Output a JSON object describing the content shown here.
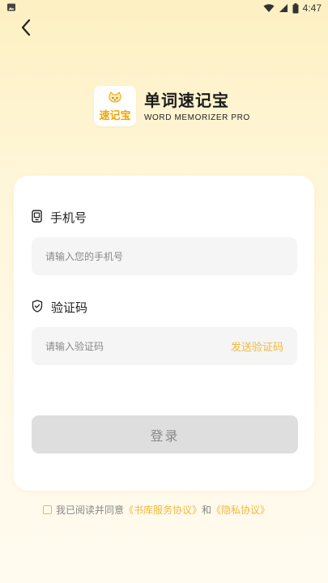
{
  "status_bar": {
    "time": "4:47",
    "left_icon": "image-icon",
    "icons": [
      "wifi-icon",
      "signal-icon",
      "battery-icon"
    ]
  },
  "nav": {
    "back_icon": "chevron-left-icon"
  },
  "brand": {
    "logo_text": "速记宝",
    "title": "单词速记宝",
    "subtitle": "WORD MEMORIZER PRO"
  },
  "form": {
    "phone": {
      "label": "手机号",
      "icon": "phone-icon",
      "placeholder": "请输入您的手机号",
      "value": ""
    },
    "code": {
      "label": "验证码",
      "icon": "shield-check-icon",
      "placeholder": "请输入验证码",
      "value": "",
      "send_label": "发送验证码"
    },
    "login_label": "登录"
  },
  "agreement": {
    "prefix": "我已阅读并同意",
    "service_link": "《书库服务协议》",
    "and": "和",
    "privacy_link": "《隐私协议》",
    "checked": false
  },
  "colors": {
    "accent": "#f0b93e",
    "background_top": "#fdf0c2",
    "background_bottom": "#fffbee",
    "card": "#ffffff",
    "input_bg": "#f5f5f5",
    "button_disabled": "#dedede"
  }
}
